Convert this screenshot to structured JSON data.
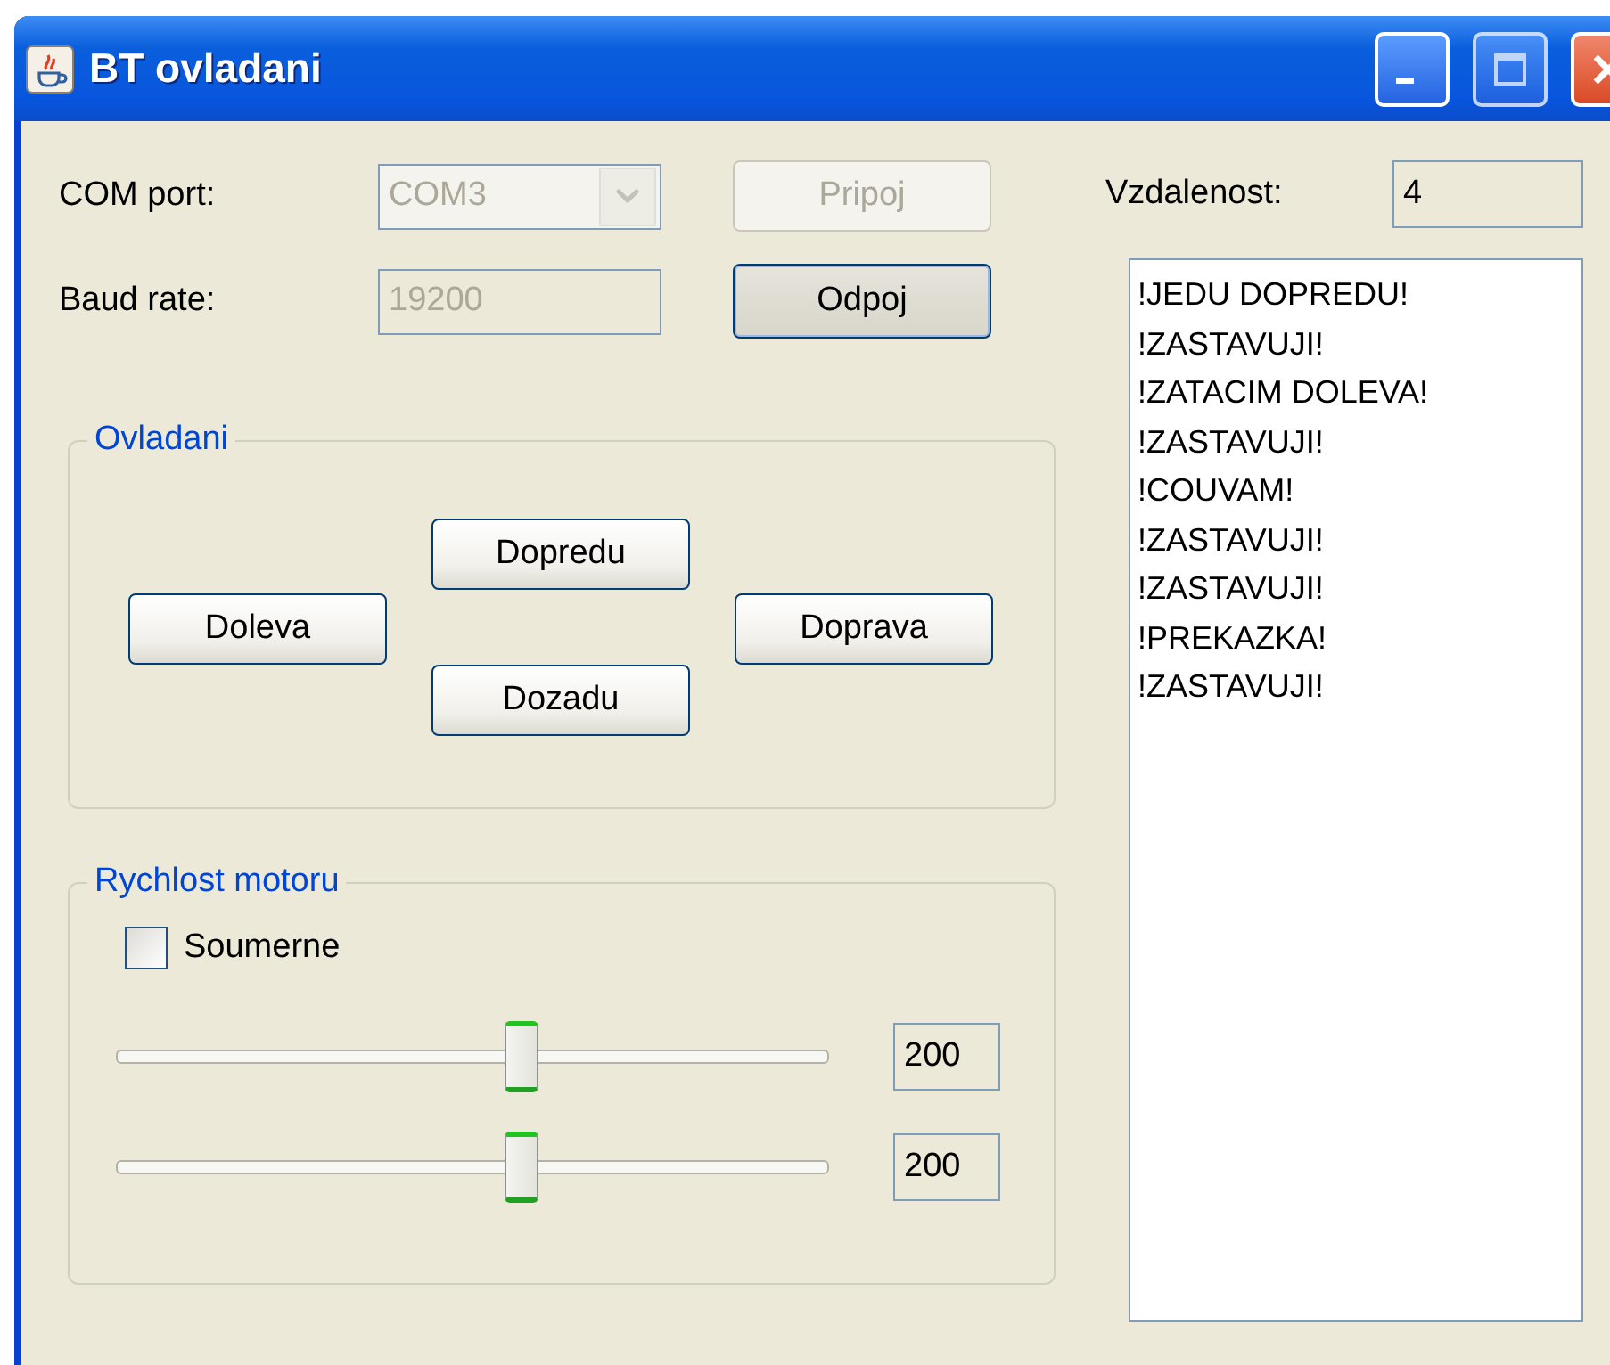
{
  "window": {
    "title": "BT ovladani"
  },
  "connection": {
    "com_port_label": "COM port:",
    "com_port": {
      "value": "COM3",
      "disabled": true
    },
    "connect_button": {
      "label": "Pripoj",
      "disabled": true,
      "focused": false
    },
    "baud_rate_label": "Baud rate:",
    "baud_rate": {
      "value": "19200",
      "disabled": true
    },
    "disconnect_button": {
      "label": "Odpoj",
      "disabled": false,
      "focused": true
    }
  },
  "distance": {
    "label": "Vzdalenost:",
    "value": "4"
  },
  "control": {
    "title": "Ovladani",
    "buttons": [
      {
        "label": "Dopredu",
        "kind": "up"
      },
      {
        "label": "Doleva",
        "kind": "left"
      },
      {
        "label": "Doprava",
        "kind": "right"
      },
      {
        "label": "Dozadu",
        "kind": "down"
      }
    ]
  },
  "speed": {
    "title": "Rychlost motoru",
    "symmetric": {
      "label": "Soumerne",
      "checked": false
    },
    "sliders": [
      {
        "level": 0.57,
        "value": "200"
      },
      {
        "level": 0.57,
        "value": "200"
      }
    ]
  },
  "log": [
    "!JEDU DOPREDU!",
    "!ZASTAVUJI!",
    "!ZATACIM DOLEVA!",
    "!ZASTAVUJI!",
    "!COUVAM!",
    "!ZASTAVUJI!",
    "!ZASTAVUJI!",
    "!PREKAZKA!",
    "!ZASTAVUJI!"
  ]
}
